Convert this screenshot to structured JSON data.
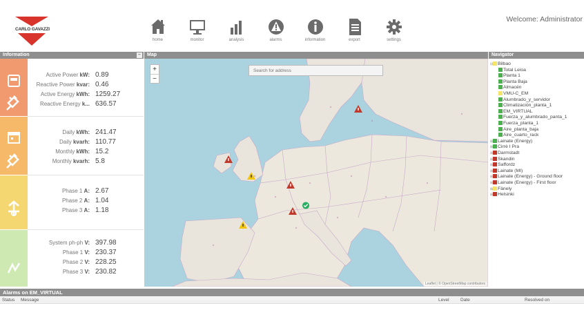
{
  "header": {
    "brand": "CARLO GAVAZZI",
    "welcome": "Welcome: Administrator",
    "toolbar": [
      {
        "label": "home",
        "icon": "home-icon"
      },
      {
        "label": "monitor",
        "icon": "monitor-icon"
      },
      {
        "label": "analysis",
        "icon": "bar-chart-icon"
      },
      {
        "label": "alarms",
        "icon": "alarm-icon"
      },
      {
        "label": "information",
        "icon": "info-icon"
      },
      {
        "label": "export",
        "icon": "document-icon"
      },
      {
        "label": "settings",
        "icon": "gear-icon"
      }
    ]
  },
  "panels": {
    "information": "Information",
    "map": "Map",
    "navigator": "Navigator",
    "collapse": "–"
  },
  "info": {
    "block1": [
      {
        "label": "Active Power",
        "unit": "kW:",
        "value": "0.89"
      },
      {
        "label": "Reactive Power",
        "unit": "kvar:",
        "value": "0.46"
      },
      {
        "label": "Active Energy",
        "unit": "kWh:",
        "value": "1259.27"
      },
      {
        "label": "Reactive Energy",
        "unit": "k...",
        "value": "636.57"
      }
    ],
    "block2": [
      {
        "label": "Daily",
        "unit": "kWh:",
        "value": "241.47"
      },
      {
        "label": "Daily",
        "unit": "kvarh:",
        "value": "110.77"
      },
      {
        "label": "Monthly",
        "unit": "kWh:",
        "value": "15.2"
      },
      {
        "label": "Monthly",
        "unit": "kvarh:",
        "value": "5.8"
      }
    ],
    "block3": [
      {
        "label": "Phase 1",
        "unit": "A:",
        "value": "2.67"
      },
      {
        "label": "Phase 2",
        "unit": "A:",
        "value": "1.04"
      },
      {
        "label": "Phase 3",
        "unit": "A:",
        "value": "1.18"
      }
    ],
    "block4": [
      {
        "label": "System ph-ph",
        "unit": "V:",
        "value": "397.98"
      },
      {
        "label": "Phase 1",
        "unit": "V:",
        "value": "230.37"
      },
      {
        "label": "Phase 2",
        "unit": "V:",
        "value": "228.25"
      },
      {
        "label": "Phase 3",
        "unit": "V:",
        "value": "230.82"
      }
    ],
    "colors": {
      "block1": "#f19a6f",
      "block2": "#f6b96a",
      "block3": "#f5d772",
      "block4": "#cfe9b2"
    }
  },
  "map": {
    "zoom_in": "+",
    "zoom_out": "−",
    "search_placeholder": "Search for address",
    "attribution": "Leaflet | © OpenStreetMap contributors",
    "markers": [
      {
        "status": "alarm",
        "color": "#c0392b"
      },
      {
        "status": "alarm",
        "color": "#c0392b"
      },
      {
        "status": "warning",
        "color": "#f1c40f"
      },
      {
        "status": "alarm",
        "color": "#c0392b"
      },
      {
        "status": "alarm",
        "color": "#c0392b"
      },
      {
        "status": "ok",
        "color": "#27ae60"
      },
      {
        "status": "warning",
        "color": "#f1c40f"
      }
    ]
  },
  "navigator": {
    "items": [
      {
        "label": "Bilbao",
        "color": "#f3e56a",
        "level": 0,
        "expander": "⊟"
      },
      {
        "label": "Total Leioa",
        "color": "#4caf50",
        "level": 1
      },
      {
        "label": "Planta 1",
        "color": "#4caf50",
        "level": 1
      },
      {
        "label": "Planta Baja",
        "color": "#4caf50",
        "level": 1
      },
      {
        "label": "Almacén",
        "color": "#4caf50",
        "level": 1
      },
      {
        "label": "VMU-C_EM",
        "color": "#f3e56a",
        "level": 1
      },
      {
        "label": "Alumbrado_y_servidor",
        "color": "#4caf50",
        "level": 1
      },
      {
        "label": "Climatización_planta_1",
        "color": "#4caf50",
        "level": 1
      },
      {
        "label": "EM_VIRTUAL",
        "color": "#4caf50",
        "level": 1
      },
      {
        "label": "Fuerza_y_alumbrado_panta_1",
        "color": "#4caf50",
        "level": 1
      },
      {
        "label": "Fuerza_planta_1",
        "color": "#4caf50",
        "level": 1
      },
      {
        "label": "Aire_planta_baja",
        "color": "#4caf50",
        "level": 1
      },
      {
        "label": "Aire_cuarto_rack",
        "color": "#4caf50",
        "level": 1
      },
      {
        "label": "Lainate (Energy)",
        "color": "#4caf50",
        "level": 0,
        "expander": "⊞"
      },
      {
        "label": "Cirrè I Pra",
        "color": "#4caf50",
        "level": 0,
        "expander": "⊞"
      },
      {
        "label": "Darmstadt",
        "color": "#c0392b",
        "level": 0,
        "expander": "⊞"
      },
      {
        "label": "Skandin",
        "color": "#c0392b",
        "level": 0,
        "expander": "⊞"
      },
      {
        "label": "Saffordz",
        "color": "#c0392b",
        "level": 0,
        "expander": "⊞"
      },
      {
        "label": "Lainate (MI)",
        "color": "#c0392b",
        "level": 0,
        "expander": "⊞"
      },
      {
        "label": "Lainate (Energy) - Ground floor",
        "color": "#c0392b",
        "level": 0,
        "expander": "⊞"
      },
      {
        "label": "Lainate (Energy) - First floor",
        "color": "#c0392b",
        "level": 0,
        "expander": "⊞"
      },
      {
        "label": "Fänely",
        "color": "#f3e56a",
        "level": 0,
        "expander": "⊞"
      },
      {
        "label": "Helsinki",
        "color": "#c0392b",
        "level": 0,
        "expander": "⊞"
      }
    ]
  },
  "alarms": {
    "title": "Alarms on EM_VIRTUAL",
    "columns": {
      "status": "Status",
      "message": "Message",
      "level": "Level",
      "date": "Date",
      "resolved": "Resolved on"
    }
  }
}
